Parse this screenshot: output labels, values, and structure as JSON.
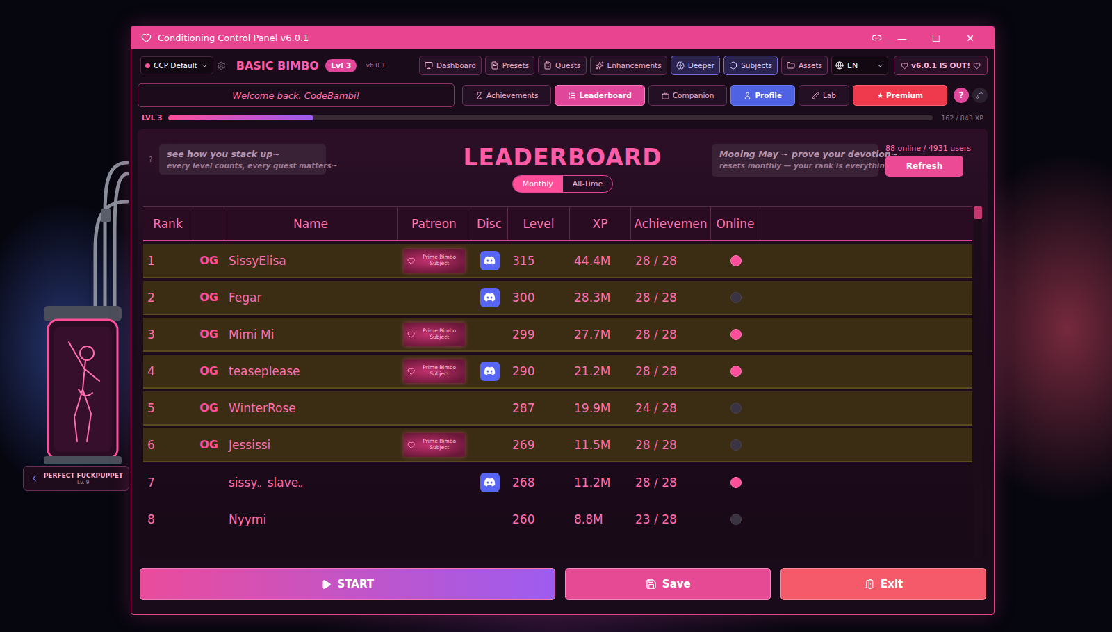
{
  "window": {
    "title": "Conditioning Control Panel v6.0.1",
    "controls": [
      "—",
      "☐",
      "✕"
    ]
  },
  "topbar": {
    "preset": "CCP Default",
    "rank": "BASIC BIMBO",
    "level_badge": "Lvl 3",
    "version": "v6.0.1",
    "nav": [
      {
        "label": "Dashboard",
        "kind": "plain"
      },
      {
        "label": "Presets",
        "kind": "plain"
      },
      {
        "label": "Quests",
        "kind": "plain"
      },
      {
        "label": "Enhancements",
        "kind": "plain"
      },
      {
        "label": "Deeper",
        "kind": "accent"
      },
      {
        "label": "Subjects",
        "kind": "accent"
      },
      {
        "label": "Assets",
        "kind": "plain"
      }
    ],
    "language": "EN",
    "update": "v6.0.1 IS OUT!"
  },
  "subbar": {
    "welcome": "Welcome back, CodeBambi!",
    "tabs": [
      {
        "label": "Achievements",
        "kind": "plain",
        "selected": false
      },
      {
        "label": "Leaderboard",
        "kind": "plain",
        "selected": true
      },
      {
        "label": "Companion",
        "kind": "plain",
        "selected": false
      },
      {
        "label": "Profile",
        "kind": "profile",
        "selected": false
      },
      {
        "label": "Lab",
        "kind": "plain",
        "selected": false
      },
      {
        "label": "★ Premium",
        "kind": "premium",
        "selected": false
      }
    ],
    "help": "?"
  },
  "xp": {
    "level": "LVL 3",
    "level_fill": 0.19,
    "reading": "162 / 843 XP"
  },
  "leaderboard": {
    "help": "?",
    "tip": [
      "see how you stack up~",
      "every level counts, every quest matters~"
    ],
    "title": "LEADERBOARD",
    "periods": [
      {
        "label": "Monthly",
        "selected": true
      },
      {
        "label": "All-Time",
        "selected": false
      }
    ],
    "event": [
      "Mooing May ~ prove your devotion~",
      "resets monthly — your rank is everything~"
    ],
    "online": "88 online / 4931 users",
    "refresh": "Refresh",
    "columns": [
      "Rank",
      "",
      "Name",
      "Patreon",
      "Disc",
      "Level",
      "XP",
      "Achievemen",
      "Online"
    ],
    "rows": [
      {
        "rank": "1",
        "og": "OG",
        "name": "SissyElisa",
        "patreon": "Prime Bimbo Subject",
        "discord": true,
        "level": "315",
        "xp": "44.4M",
        "achievements": "28 / 28",
        "online": true
      },
      {
        "rank": "2",
        "og": "OG",
        "name": "Fegar",
        "patreon": "",
        "discord": true,
        "level": "300",
        "xp": "28.3M",
        "achievements": "28 / 28",
        "online": false
      },
      {
        "rank": "3",
        "og": "OG",
        "name": "Mimi  Mi",
        "patreon": "Prime Bimbo Subject",
        "discord": false,
        "level": "299",
        "xp": "27.7M",
        "achievements": "28 / 28",
        "online": true
      },
      {
        "rank": "4",
        "og": "OG",
        "name": "teaseplease",
        "patreon": "Prime Bimbo Subject",
        "discord": true,
        "level": "290",
        "xp": "21.2M",
        "achievements": "28 / 28",
        "online": true
      },
      {
        "rank": "5",
        "og": "OG",
        "name": "WinterRose",
        "patreon": "",
        "discord": false,
        "level": "287",
        "xp": "19.9M",
        "achievements": "24 / 28",
        "online": false
      },
      {
        "rank": "6",
        "og": "OG",
        "name": "Jessissi",
        "patreon": "Prime Bimbo Subject",
        "discord": false,
        "level": "269",
        "xp": "11.5M",
        "achievements": "28 / 28",
        "online": false
      },
      {
        "rank": "7",
        "og": "",
        "name": "sissy｡ slave｡",
        "patreon": "",
        "discord": true,
        "level": "268",
        "xp": "11.2M",
        "achievements": "28 / 28",
        "online": true
      },
      {
        "rank": "8",
        "og": "",
        "name": "Nyymi",
        "patreon": "",
        "discord": false,
        "level": "260",
        "xp": "8.8M",
        "achievements": "23 / 28",
        "online": false
      }
    ],
    "scroll": {
      "level": 0
    }
  },
  "footer": {
    "start": "START",
    "save": "Save",
    "exit": "Exit"
  },
  "companion": {
    "name": "PERFECT FUCKPUPPET",
    "level": "Lv. 9"
  }
}
